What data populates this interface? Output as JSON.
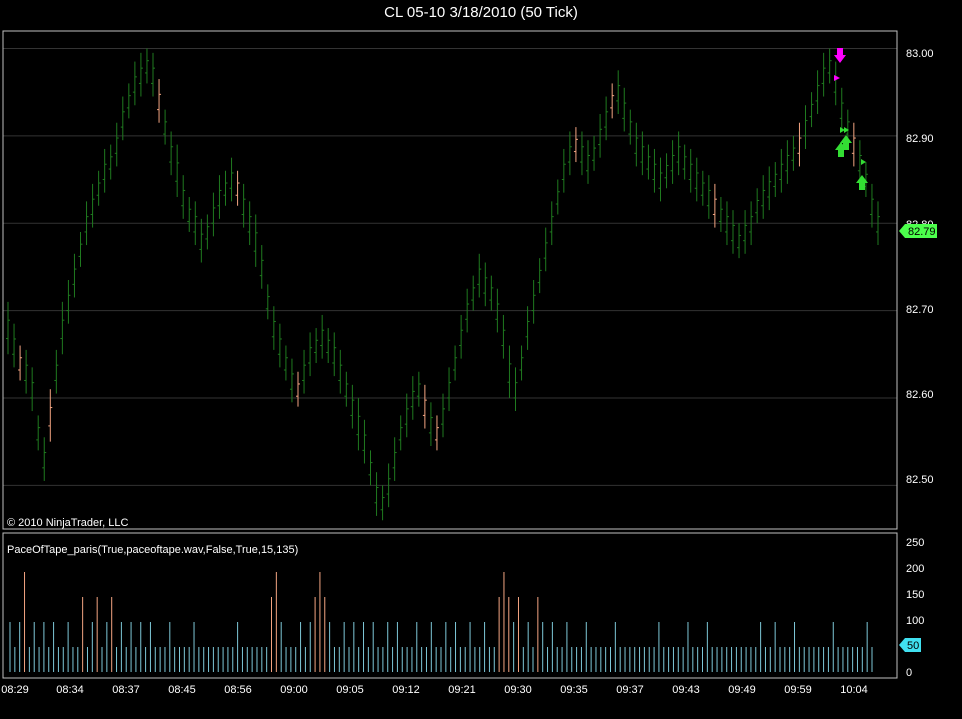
{
  "window": {
    "title": "CL 05-10  3/18/2010 (50 Tick)",
    "copyright": "© 2010 NinjaTrader, LLC"
  },
  "colors": {
    "background": "#000000",
    "bar_up": "#1f7a1f",
    "bar_dark": "#2e8b2e",
    "bar_highlight": "#f4a582",
    "gridline": "#333333",
    "axis_border": "#c0c0c0",
    "price_marker": "#4cff4c",
    "pace_bar": "#7ec8d8",
    "pace_bar_hot": "#f4a582",
    "pace_marker": "#40e0f0",
    "signal_sell": "#ff00ff",
    "signal_buy": "#33dd33"
  },
  "price_panel": {
    "y_ticks": [
      "83.00",
      "82.90",
      "82.80",
      "82.70",
      "82.60",
      "82.50"
    ],
    "last_price": "82.79"
  },
  "indicator_panel": {
    "label": "PaceOfTape_paris(True,paceoftape.wav,False,True,15,135)",
    "y_ticks": [
      "250",
      "200",
      "150",
      "100",
      "50",
      "0"
    ],
    "last_value": "50"
  },
  "x_axis": {
    "ticks": [
      "08:29",
      "08:34",
      "08:37",
      "08:45",
      "08:56",
      "09:00",
      "09:05",
      "09:12",
      "09:21",
      "09:30",
      "09:35",
      "09:37",
      "09:43",
      "09:49",
      "09:59",
      "10:04"
    ]
  },
  "chart_data": {
    "type": "line",
    "price": {
      "ylim": [
        82.45,
        83.02
      ],
      "mid": [
        82.68,
        82.66,
        82.64,
        82.63,
        82.61,
        82.56,
        82.53,
        82.58,
        82.63,
        82.68,
        82.71,
        82.74,
        82.77,
        82.8,
        82.82,
        82.84,
        82.86,
        82.87,
        82.89,
        82.92,
        82.94,
        82.96,
        82.97,
        82.98,
        82.97,
        82.94,
        82.91,
        82.88,
        82.86,
        82.83,
        82.81,
        82.8,
        82.78,
        82.79,
        82.81,
        82.83,
        82.84,
        82.85,
        82.84,
        82.82,
        82.8,
        82.78,
        82.75,
        82.71,
        82.68,
        82.66,
        82.64,
        82.62,
        82.61,
        82.63,
        82.65,
        82.66,
        82.67,
        82.66,
        82.65,
        82.63,
        82.61,
        82.59,
        82.57,
        82.55,
        82.52,
        82.49,
        82.48,
        82.5,
        82.53,
        82.56,
        82.58,
        82.6,
        82.61,
        82.59,
        82.57,
        82.56,
        82.58,
        82.61,
        82.64,
        82.67,
        82.7,
        82.72,
        82.74,
        82.73,
        82.72,
        82.7,
        82.67,
        82.63,
        82.61,
        82.64,
        82.68,
        82.71,
        82.74,
        82.77,
        82.8,
        82.83,
        82.86,
        82.88,
        82.89,
        82.88,
        82.87,
        82.88,
        82.9,
        82.92,
        82.94,
        82.95,
        82.93,
        82.91,
        82.89,
        82.88,
        82.87,
        82.86,
        82.85,
        82.86,
        82.87,
        82.88,
        82.87,
        82.86,
        82.85,
        82.84,
        82.83,
        82.82,
        82.81,
        82.8,
        82.79,
        82.78,
        82.79,
        82.8,
        82.82,
        82.83,
        82.84,
        82.85,
        82.86,
        82.87,
        82.88,
        82.89,
        82.91,
        82.93,
        82.95,
        82.97,
        82.98,
        82.96,
        82.93,
        82.91,
        82.89,
        82.87,
        82.85,
        82.82,
        82.8
      ],
      "range": [
        0.06,
        0.05,
        0.04,
        0.05,
        0.05,
        0.04,
        0.05,
        0.06,
        0.05,
        0.06,
        0.05,
        0.05,
        0.04,
        0.05,
        0.05,
        0.04,
        0.05,
        0.04,
        0.05,
        0.05,
        0.04,
        0.05,
        0.05,
        0.04,
        0.05,
        0.05,
        0.04,
        0.05,
        0.06,
        0.05,
        0.04,
        0.05,
        0.05,
        0.04,
        0.05,
        0.05,
        0.04,
        0.05,
        0.04,
        0.05,
        0.05,
        0.06,
        0.05,
        0.04,
        0.05,
        0.05,
        0.04,
        0.05,
        0.04,
        0.05,
        0.05,
        0.04,
        0.05,
        0.04,
        0.05,
        0.05,
        0.04,
        0.05,
        0.06,
        0.05,
        0.04,
        0.05,
        0.04,
        0.05,
        0.05,
        0.04,
        0.05,
        0.05,
        0.04,
        0.05,
        0.05,
        0.04,
        0.05,
        0.05,
        0.04,
        0.05,
        0.05,
        0.04,
        0.05,
        0.05,
        0.04,
        0.05,
        0.05,
        0.06,
        0.05,
        0.04,
        0.05,
        0.05,
        0.04,
        0.05,
        0.05,
        0.04,
        0.05,
        0.05,
        0.04,
        0.05,
        0.05,
        0.04,
        0.05,
        0.05,
        0.04,
        0.05,
        0.05,
        0.04,
        0.05,
        0.05,
        0.04,
        0.05,
        0.05,
        0.04,
        0.05,
        0.05,
        0.04,
        0.05,
        0.05,
        0.04,
        0.05,
        0.05,
        0.04,
        0.05,
        0.05,
        0.04,
        0.05,
        0.05,
        0.04,
        0.05,
        0.05,
        0.04,
        0.05,
        0.05,
        0.04,
        0.05,
        0.05,
        0.04,
        0.05,
        0.05,
        0.04,
        0.05,
        0.05,
        0.04,
        0.05,
        0.05,
        0.04,
        0.05,
        0.05
      ]
    },
    "pace": {
      "ylim": [
        0,
        260
      ],
      "values": [
        100,
        50,
        100,
        200,
        50,
        100,
        50,
        100,
        50,
        100,
        50,
        50,
        100,
        50,
        50,
        150,
        50,
        100,
        150,
        50,
        100,
        150,
        50,
        100,
        50,
        100,
        50,
        100,
        50,
        100,
        50,
        50,
        50,
        100,
        50,
        50,
        50,
        50,
        100,
        50,
        50,
        50,
        50,
        50,
        50,
        50,
        50,
        100,
        50,
        50,
        50,
        50,
        50,
        50,
        150,
        200,
        100,
        50,
        50,
        50,
        100,
        50,
        100,
        150,
        200,
        150,
        100,
        50,
        50,
        100,
        50,
        100,
        50,
        100,
        50,
        100,
        50,
        50,
        100,
        50,
        100,
        50,
        50,
        50,
        100,
        50,
        50,
        100,
        50,
        50,
        100,
        50,
        100,
        50,
        50,
        100,
        50,
        50,
        100,
        50,
        50,
        150,
        200,
        150,
        100,
        150,
        50,
        100,
        50,
        150,
        100,
        50,
        100,
        50,
        50,
        100,
        50,
        50,
        50,
        100,
        50,
        50,
        50,
        50,
        50,
        100,
        50,
        50,
        50,
        50,
        50,
        50,
        50,
        50,
        100,
        50,
        50,
        50,
        50,
        50,
        100,
        50,
        50,
        50,
        100,
        50,
        50,
        50,
        50,
        50,
        50,
        50,
        50,
        50,
        50,
        100,
        50,
        50,
        100,
        50,
        50,
        50,
        100,
        50,
        50,
        50,
        50,
        50,
        50,
        50,
        100,
        50,
        50,
        50,
        50,
        50,
        50,
        100,
        50
      ]
    }
  }
}
